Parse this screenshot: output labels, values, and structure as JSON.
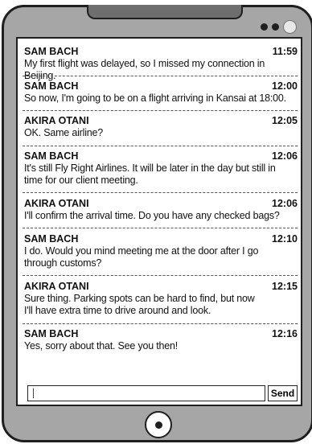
{
  "messages": [
    {
      "sender": "SAM BACH",
      "time": "11:59",
      "text": [
        "My first flight was delayed, so I missed my connection in Beijing."
      ]
    },
    {
      "sender": "SAM BACH",
      "time": "12:00",
      "text": [
        "So now, I'm going to be on a flight arriving in Kansai at 18:00."
      ]
    },
    {
      "sender": "AKIRA OTANI",
      "time": "12:05",
      "text": [
        "OK. Same airline?"
      ]
    },
    {
      "sender": "SAM BACH",
      "time": "12:06",
      "text": [
        "It's still Fly Right Airlines. It will be later in the day but still in",
        "time for our client meeting."
      ]
    },
    {
      "sender": "AKIRA OTANI",
      "time": "12:06",
      "text": [
        "I'll confirm the arrival time. Do you have any checked bags?"
      ]
    },
    {
      "sender": "SAM BACH",
      "time": "12:10",
      "text": [
        "I do. Would you mind meeting me at the door after I go",
        "through customs?"
      ]
    },
    {
      "sender": "AKIRA OTANI",
      "time": "12:15",
      "text": [
        "Sure thing. Parking spots can be hard to find, but now",
        "I'll have extra time to drive around and look."
      ]
    },
    {
      "sender": "SAM BACH",
      "time": "12:16",
      "text": [
        "Yes, sorry about that. See you then!"
      ]
    }
  ],
  "composer": {
    "input_value": "",
    "send_label": "Send"
  }
}
